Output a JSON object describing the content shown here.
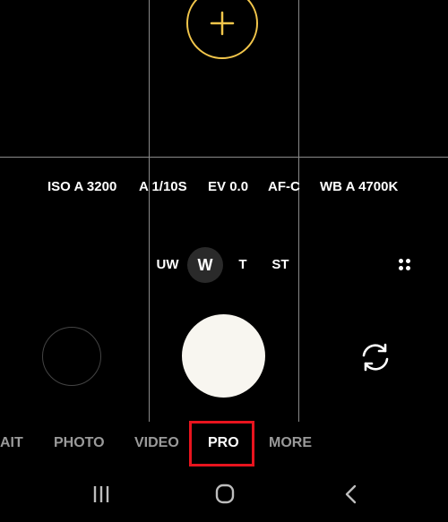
{
  "camera_settings": [
    {
      "label": "ISO",
      "value": "A 3200"
    },
    {
      "label": "A",
      "value": "1/10S"
    },
    {
      "label": "EV",
      "value": "0.0"
    },
    {
      "label": "",
      "value": "AF-C"
    },
    {
      "label": "WB",
      "value": "A 4700K"
    }
  ],
  "zoom": {
    "uw": "UW",
    "w": "W",
    "t": "T",
    "st": "ST",
    "active": "W"
  },
  "modes": [
    {
      "label": "AIT",
      "active": false
    },
    {
      "label": "PHOTO",
      "active": false
    },
    {
      "label": "VIDEO",
      "active": false
    },
    {
      "label": "PRO",
      "active": true
    },
    {
      "label": "MORE",
      "active": false
    }
  ],
  "icons": {
    "focus": "focus-plus-icon",
    "more": "more-dots-icon",
    "switch_camera": "switch-camera-icon",
    "recents": "recents-icon",
    "home": "home-icon",
    "back": "back-icon"
  },
  "colors": {
    "focus_ring": "#f2c64b",
    "highlight": "#e8141e",
    "active_mode": "#ffffff",
    "inactive_mode": "#9a9a9a"
  }
}
